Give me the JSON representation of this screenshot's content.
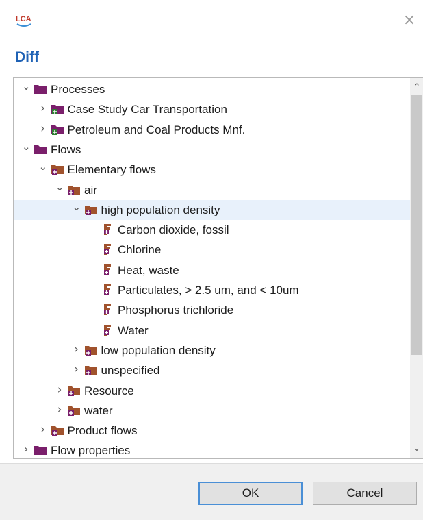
{
  "window": {
    "logo_text": "LCA",
    "title": "Diff",
    "close_glyph": "×"
  },
  "colors": {
    "title": "#1f62b5",
    "folder": "#7a1f6b",
    "flow_folder": "#a0522d",
    "selection": "#e8f1fb"
  },
  "tree": [
    {
      "label": "Processes",
      "level": 0,
      "expander": "expanded",
      "icon": "category-folder-icon"
    },
    {
      "label": "Case Study Car Transportation",
      "level": 1,
      "expander": "collapsed",
      "icon": "process-folder-icon"
    },
    {
      "label": "Petroleum and Coal Products Mnf.",
      "level": 1,
      "expander": "collapsed",
      "icon": "process-folder-icon"
    },
    {
      "label": "Flows",
      "level": 0,
      "expander": "expanded",
      "icon": "category-folder-icon"
    },
    {
      "label": "Elementary flows",
      "level": 1,
      "expander": "expanded",
      "icon": "flow-folder-icon"
    },
    {
      "label": "air",
      "level": 2,
      "expander": "expanded",
      "icon": "flow-folder-icon"
    },
    {
      "label": "high population density",
      "level": 3,
      "expander": "expanded",
      "icon": "flow-folder-icon",
      "selected": true
    },
    {
      "label": "Carbon dioxide, fossil",
      "level": 4,
      "expander": "none",
      "icon": "elementary-flow-icon"
    },
    {
      "label": "Chlorine",
      "level": 4,
      "expander": "none",
      "icon": "elementary-flow-icon"
    },
    {
      "label": "Heat, waste",
      "level": 4,
      "expander": "none",
      "icon": "elementary-flow-icon"
    },
    {
      "label": "Particulates, > 2.5 um, and < 10um",
      "level": 4,
      "expander": "none",
      "icon": "elementary-flow-icon"
    },
    {
      "label": "Phosphorus trichloride",
      "level": 4,
      "expander": "none",
      "icon": "elementary-flow-icon"
    },
    {
      "label": "Water",
      "level": 4,
      "expander": "none",
      "icon": "elementary-flow-icon"
    },
    {
      "label": "low population density",
      "level": 3,
      "expander": "collapsed",
      "icon": "flow-folder-icon"
    },
    {
      "label": "unspecified",
      "level": 3,
      "expander": "collapsed",
      "icon": "flow-folder-icon"
    },
    {
      "label": "Resource",
      "level": 2,
      "expander": "collapsed",
      "icon": "flow-folder-icon"
    },
    {
      "label": "water",
      "level": 2,
      "expander": "collapsed",
      "icon": "flow-folder-icon"
    },
    {
      "label": "Product flows",
      "level": 1,
      "expander": "collapsed",
      "icon": "flow-folder-icon"
    },
    {
      "label": "Flow properties",
      "level": 0,
      "expander": "collapsed",
      "icon": "category-folder-icon"
    }
  ],
  "buttons": {
    "ok": "OK",
    "cancel": "Cancel"
  }
}
